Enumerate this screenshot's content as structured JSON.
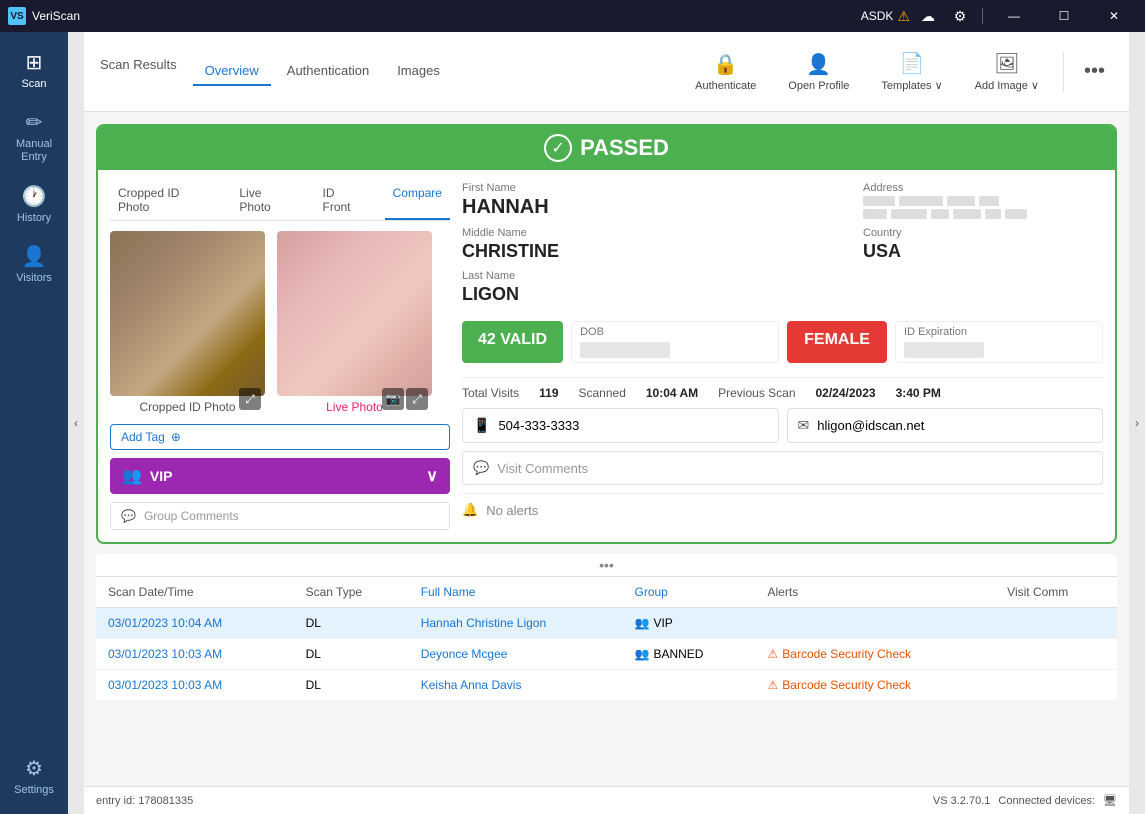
{
  "app": {
    "name": "VeriScan",
    "title": "VeriScan"
  },
  "titlebar": {
    "logo": "VS",
    "title": "VeriScan",
    "asdk": "ASDK",
    "warn_icon": "⚠",
    "cloud_icon": "☁",
    "settings_icon": "⚙",
    "sep": "|",
    "min_icon": "—",
    "max_icon": "☐",
    "close_icon": "✕"
  },
  "sidebar": {
    "items": [
      {
        "id": "scan",
        "label": "Scan",
        "icon": "⊞"
      },
      {
        "id": "manual-entry",
        "label": "Manual\nEntry",
        "icon": "✏"
      },
      {
        "id": "history",
        "label": "History",
        "icon": "🕐"
      },
      {
        "id": "visitors",
        "label": "Visitors",
        "icon": "👤"
      },
      {
        "id": "settings",
        "label": "Settings",
        "icon": "⚙"
      }
    ]
  },
  "toolbar": {
    "scan_results_label": "Scan Results",
    "tabs": [
      {
        "id": "overview",
        "label": "Overview",
        "active": true
      },
      {
        "id": "authentication",
        "label": "Authentication"
      },
      {
        "id": "images",
        "label": "Images"
      }
    ],
    "actions": [
      {
        "id": "authenticate",
        "label": "Authenticate",
        "icon": "🔒"
      },
      {
        "id": "open-profile",
        "label": "Open Profile",
        "icon": "👤"
      },
      {
        "id": "templates",
        "label": "Templates ∨",
        "icon": "📄"
      },
      {
        "id": "add-image",
        "label": "Add Image ∨",
        "icon": "🖼"
      }
    ],
    "more_label": "•••"
  },
  "result": {
    "status": "PASSED",
    "photo_tabs": [
      "Cropped ID Photo",
      "Live Photo",
      "ID Front",
      "Compare"
    ],
    "active_photo_tab": "Compare",
    "photo_label_1": "Cropped ID Photo",
    "photo_label_2": "Live Photo",
    "first_name_label": "First Name",
    "first_name": "HANNAH",
    "middle_name_label": "Middle Name",
    "middle_name": "CHRISTINE",
    "last_name_label": "Last Name",
    "last_name": "LIGON",
    "address_label": "Address",
    "country_label": "Country",
    "country": "USA",
    "valid_badge": "42 VALID",
    "dob_label": "DOB",
    "gender_badge": "FEMALE",
    "id_exp_label": "ID Expiration",
    "total_visits_label": "Total Visits",
    "total_visits": "119",
    "scanned_label": "Scanned",
    "scanned_time": "10:04 AM",
    "previous_scan_label": "Previous Scan",
    "previous_scan_date": "02/24/2023",
    "previous_scan_time": "3:40 PM",
    "phone": "504-333-3333",
    "email": "hligon@idscan.net",
    "visit_comments_placeholder": "Visit Comments",
    "group_comments_placeholder": "Group Comments",
    "add_tag_label": "Add Tag",
    "vip_label": "VIP",
    "no_alerts_label": "No alerts"
  },
  "history": {
    "more_dots": "...",
    "columns": [
      "Scan Date/Time",
      "Scan Type",
      "Full Name",
      "Group",
      "Alerts",
      "Visit Comm"
    ],
    "rows": [
      {
        "date": "03/01/2023 10:04 AM",
        "type": "DL",
        "name": "Hannah Christine Ligon",
        "group": "VIP",
        "group_type": "vip",
        "alerts": "",
        "selected": true
      },
      {
        "date": "03/01/2023 10:03 AM",
        "type": "DL",
        "name": "Deyonce Mcgee",
        "group": "BANNED",
        "group_type": "banned",
        "alerts": "Barcode Security Check",
        "selected": false
      },
      {
        "date": "03/01/2023 10:03 AM",
        "type": "DL",
        "name": "Keisha Anna Davis",
        "group": "",
        "group_type": "",
        "alerts": "Barcode Security Check",
        "selected": false
      }
    ]
  },
  "statusbar": {
    "entry_id_label": "entry id:",
    "entry_id": "178081335",
    "version": "VS 3.2.70.1",
    "connected_label": "Connected devices:",
    "device_icon": "🖥"
  }
}
